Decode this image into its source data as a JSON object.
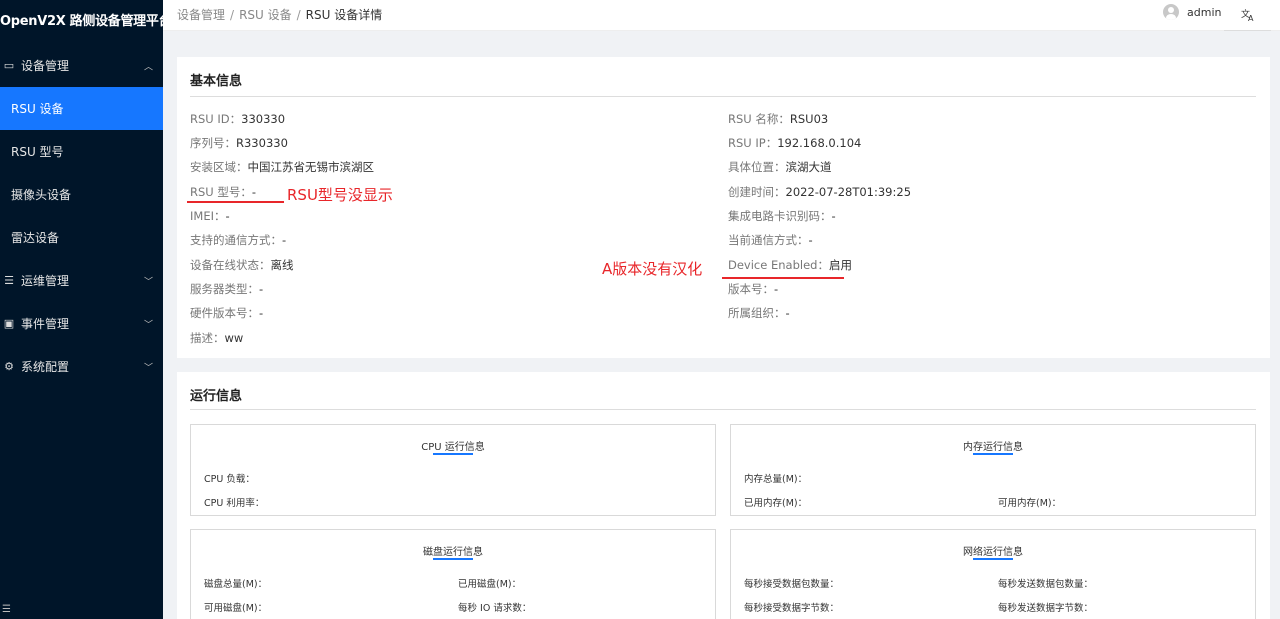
{
  "app": {
    "title": "OpenV2X 路侧设备管理平台"
  },
  "sidebar": {
    "groups": [
      {
        "label": "设备管理",
        "icon": "device-icon"
      },
      {
        "label": "运维管理",
        "icon": "ops-icon"
      },
      {
        "label": "事件管理",
        "icon": "event-icon"
      },
      {
        "label": "系统配置",
        "icon": "settings-icon"
      }
    ],
    "items": [
      {
        "label": "RSU 设备"
      },
      {
        "label": "RSU 型号"
      },
      {
        "label": "摄像头设备"
      },
      {
        "label": "雷达设备"
      }
    ]
  },
  "header": {
    "breadcrumb": [
      "设备管理",
      "RSU 设备",
      "RSU 设备详情"
    ],
    "separator": "/",
    "user": "admin",
    "lang_icon": "translate-icon"
  },
  "basic": {
    "title": "基本信息",
    "left": [
      {
        "label": "RSU ID：",
        "value": "330330"
      },
      {
        "label": "序列号：",
        "value": "R330330"
      },
      {
        "label": "安装区域：",
        "value": "中国江苏省无锡市滨湖区"
      },
      {
        "label": "RSU 型号：",
        "value": "-"
      },
      {
        "label": "IMEI：",
        "value": "-"
      },
      {
        "label": "支持的通信方式：",
        "value": "-"
      },
      {
        "label": "设备在线状态：",
        "value": "离线"
      },
      {
        "label": "服务器类型：",
        "value": "-"
      },
      {
        "label": "硬件版本号：",
        "value": "-"
      },
      {
        "label": "描述：",
        "value": "ww"
      }
    ],
    "right": [
      {
        "label": "RSU 名称：",
        "value": "RSU03"
      },
      {
        "label": "RSU IP：",
        "value": "192.168.0.104"
      },
      {
        "label": "具体位置：",
        "value": "滨湖大道"
      },
      {
        "label": "创建时间：",
        "value": "2022-07-28T01:39:25"
      },
      {
        "label": "集成电路卡识别码：",
        "value": "-"
      },
      {
        "label": "当前通信方式：",
        "value": "-"
      },
      {
        "label": "Device Enabled：",
        "value": "启用"
      },
      {
        "label": "版本号：",
        "value": "-"
      },
      {
        "label": "所属组织：",
        "value": "-"
      }
    ]
  },
  "annotations": {
    "model_note": "RSU型号没显示",
    "i18n_note": "A版本没有汉化",
    "color": "#e8262a"
  },
  "runtime": {
    "title": "运行信息",
    "cpu": {
      "title": "CPU 运行信息",
      "fields": [
        "CPU 负载：",
        "CPU 利用率："
      ]
    },
    "memory": {
      "title": "内存运行信息",
      "fields": [
        "内存总量(M)：",
        "已用内存(M)：",
        "可用内存(M)："
      ]
    },
    "disk": {
      "title": "磁盘运行信息",
      "fields": [
        "磁盘总量(M)：",
        "已用磁盘(M)：",
        "可用磁盘(M)：",
        "每秒 IO 请求数："
      ]
    },
    "network": {
      "title": "网络运行信息",
      "fields": [
        "每秒接受数据包数量：",
        "每秒发送数据包数量：",
        "每秒接受数据字节数：",
        "每秒发送数据字节数："
      ]
    }
  },
  "colors": {
    "sidebar_bg": "#001529",
    "accent": "#1677ff",
    "annotation": "#e8262a"
  }
}
